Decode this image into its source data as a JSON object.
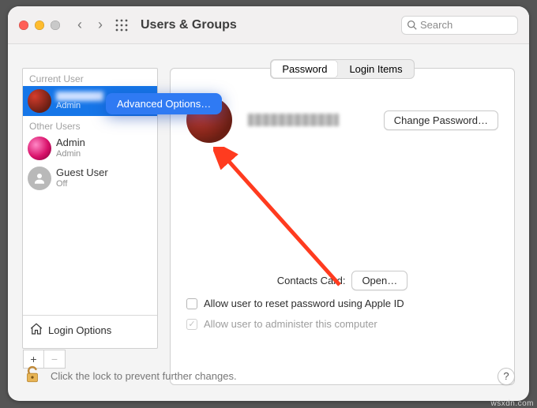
{
  "window": {
    "title": "Users & Groups",
    "search_placeholder": "Search"
  },
  "sidebar": {
    "sections": {
      "current": "Current User",
      "other": "Other Users"
    },
    "current_user": {
      "name_hidden": true,
      "role": "Admin"
    },
    "others": [
      {
        "name": "Admin",
        "role": "Admin"
      },
      {
        "name": "Guest User",
        "role": "Off"
      }
    ],
    "login_options": "Login Options",
    "add": "+",
    "remove": "−"
  },
  "context_menu": {
    "advanced": "Advanced Options…"
  },
  "detail": {
    "tabs": {
      "password": "Password",
      "login_items": "Login Items"
    },
    "change_password": "Change Password…",
    "contacts_label": "Contacts Card:",
    "open": "Open…",
    "reset_pw": "Allow user to reset password using Apple ID",
    "administer": "Allow user to administer this computer"
  },
  "lock": {
    "text": "Click the lock to prevent further changes."
  },
  "help": "?",
  "watermark": "wsxdn.com"
}
